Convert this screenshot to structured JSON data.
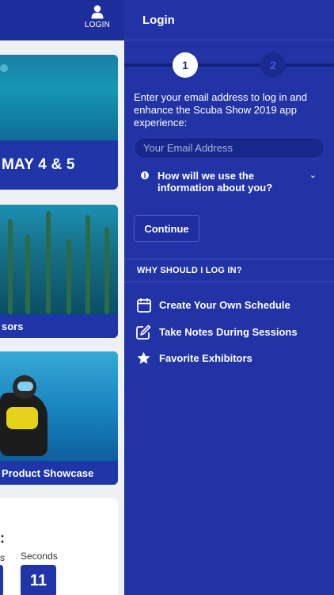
{
  "header": {
    "login_label": "LOGIN"
  },
  "cards": [
    {
      "caption": "MAY 4 & 5"
    },
    {
      "caption": "sors"
    },
    {
      "caption": "Product Showcase"
    }
  ],
  "countdown": {
    "colon": ":",
    "seconds_label": "Seconds",
    "seconds_value": "11",
    "left_frag": "s"
  },
  "panel": {
    "title": "Login",
    "steps": [
      "1",
      "2"
    ],
    "intro": "Enter your email address to log in and enhance the Scuba Show 2019 app experience:",
    "email_placeholder": "Your Email Address",
    "info_question": "How will we use the information about you?",
    "continue_label": "Continue",
    "why_heading": "WHY SHOULD I LOG IN?",
    "benefits": [
      {
        "icon": "calendar-icon",
        "label": "Create Your Own Schedule"
      },
      {
        "icon": "edit-note-icon",
        "label": "Take Notes During Sessions"
      },
      {
        "icon": "star-icon",
        "label": "Favorite Exhibitors"
      }
    ]
  },
  "colors": {
    "panel": "#2233a5",
    "topbar": "#1e2f9c",
    "accent": "#1f35a8"
  }
}
